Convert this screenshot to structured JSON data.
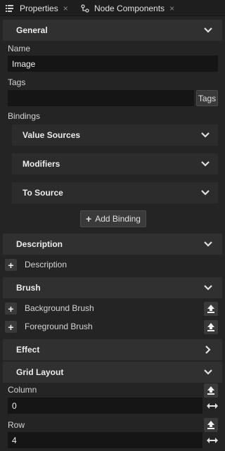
{
  "tabs": [
    {
      "label": "Properties",
      "icon": "properties-list-icon",
      "close": "×"
    },
    {
      "label": "Node Components",
      "icon": "node-components-icon",
      "close": "×"
    }
  ],
  "sections": {
    "general": "General",
    "description": "Description",
    "brush": "Brush",
    "effect": "Effect",
    "grid_layout": "Grid Layout"
  },
  "general": {
    "name_label": "Name",
    "name_value": "Image",
    "tags_label": "Tags",
    "tags_value": "",
    "tags_button": "Tags",
    "bindings_label": "Bindings",
    "value_sources": "Value Sources",
    "modifiers": "Modifiers",
    "to_source": "To Source",
    "add_binding": "Add Binding"
  },
  "description": {
    "add_label": "Description"
  },
  "brush": {
    "background": "Background Brush",
    "foreground": "Foreground Brush"
  },
  "grid_layout": {
    "column_label": "Column",
    "column_value": "0",
    "row_label": "Row",
    "row_value": "4"
  },
  "colors": {
    "background": "#242424",
    "section_header": "#303030",
    "input": "#151515",
    "text": "#d8d8d8"
  }
}
